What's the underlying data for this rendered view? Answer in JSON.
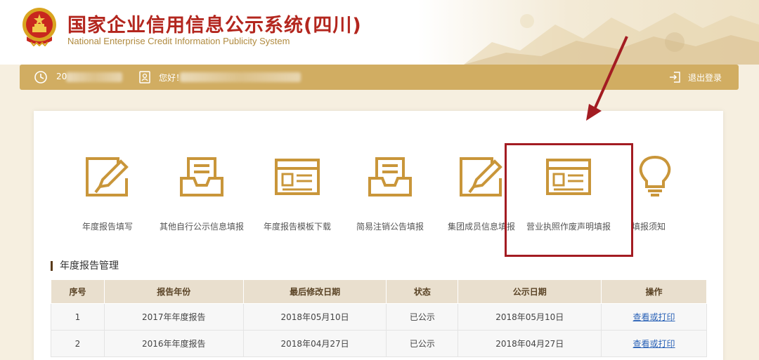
{
  "header": {
    "title_cn": "国家企业信用信息公示系统(四川)",
    "title_en": "National Enterprise Credit Information Publicity System"
  },
  "userbar": {
    "date_prefix": "20",
    "greeting": "您好！",
    "logout_label": "退出登录"
  },
  "functions": [
    {
      "label": "年度报告填写",
      "icon": "edit-pencil-icon"
    },
    {
      "label": "其他自行公示信息填报",
      "icon": "inbox-tray-icon"
    },
    {
      "label": "年度报告模板下载",
      "icon": "document-card-icon"
    },
    {
      "label": "简易注销公告填报",
      "icon": "inbox-tray-icon"
    },
    {
      "label": "集团成员信息填报",
      "icon": "edit-pencil-icon"
    },
    {
      "label": "营业执照作废声明填报",
      "icon": "document-card-icon"
    },
    {
      "label": "填报须知",
      "icon": "lightbulb-icon"
    }
  ],
  "section": {
    "title": "年度报告管理"
  },
  "table": {
    "headers": [
      "序号",
      "报告年份",
      "最后修改日期",
      "状态",
      "公示日期",
      "操作"
    ],
    "rows": [
      {
        "no": "1",
        "year": "2017年年度报告",
        "modified": "2018年05月10日",
        "status": "已公示",
        "published": "2018年05月10日",
        "action": "查看或打印"
      },
      {
        "no": "2",
        "year": "2016年年度报告",
        "modified": "2018年04月27日",
        "status": "已公示",
        "published": "2018年04月27日",
        "action": "查看或打印"
      }
    ]
  },
  "colors": {
    "brand_red": "#b3261e",
    "gold": "#d1ad62",
    "icon_gold": "#c9963a",
    "highlight": "#a31c22",
    "link": "#2a62b7"
  }
}
